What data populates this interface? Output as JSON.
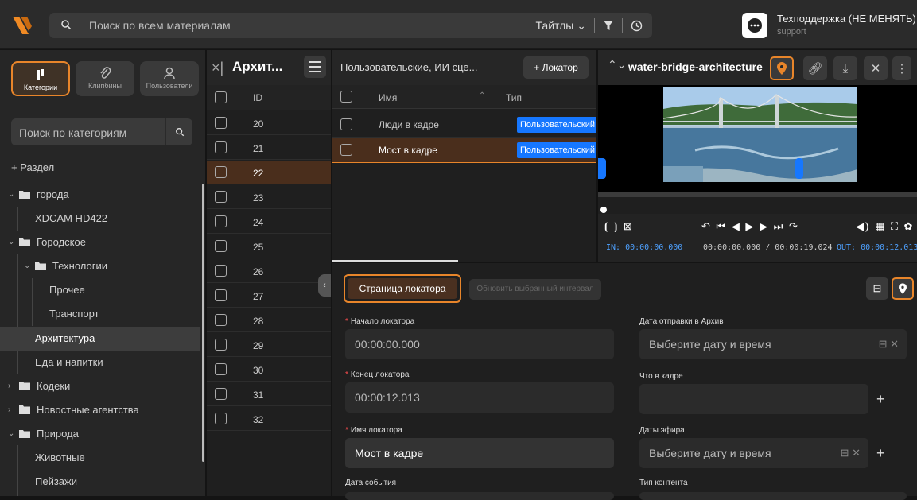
{
  "topbar": {
    "search_placeholder": "Поиск по всем материалам",
    "filter_label": "Тайтлы",
    "support_name": "Техподдержка (НЕ МЕНЯТЬ)",
    "support_role": "support"
  },
  "left": {
    "tabs": [
      {
        "label": "Категории",
        "icon": "categories-icon",
        "active": true
      },
      {
        "label": "Клипбины",
        "icon": "paperclip-icon",
        "active": false
      },
      {
        "label": "Пользователи",
        "icon": "user-icon",
        "active": false
      }
    ],
    "search_placeholder": "Поиск по категориям",
    "add_section": "+ Раздел",
    "tree": [
      {
        "label": "города",
        "level": 0,
        "folder": true,
        "expanded": true
      },
      {
        "label": "XDCAM HD422",
        "level": 1
      },
      {
        "label": "Городское",
        "level": 0,
        "folder": true,
        "expanded": true
      },
      {
        "label": "Технологии",
        "level": 1,
        "folder": true,
        "expanded": true
      },
      {
        "label": "Прочее",
        "level": 2
      },
      {
        "label": "Транспорт",
        "level": 2
      },
      {
        "label": "Архитектура",
        "level": 1,
        "selected": true
      },
      {
        "label": "Еда и напитки",
        "level": 1
      },
      {
        "label": "Кодеки",
        "level": 0,
        "folder": true,
        "expanded": false
      },
      {
        "label": "Новостные агентства",
        "level": 0,
        "folder": true,
        "expanded": false
      },
      {
        "label": "Природа",
        "level": 0,
        "folder": true,
        "expanded": true
      },
      {
        "label": "Животные",
        "level": 1
      },
      {
        "label": "Пейзажи",
        "level": 1
      }
    ]
  },
  "ids": {
    "title": "Архит...",
    "col_id": "ID",
    "rows": [
      "20",
      "21",
      "22",
      "23",
      "24",
      "25",
      "26",
      "27",
      "28",
      "29",
      "30",
      "31",
      "32"
    ],
    "selected": "22"
  },
  "locators": {
    "select_label": "Пользовательские, ИИ сце...",
    "add_button": "+ Локатор",
    "col_name": "Имя",
    "col_type": "Тип",
    "rows": [
      {
        "name": "Люди в кадре",
        "type": "Пользовательский"
      },
      {
        "name": "Мост в кадре",
        "type": "Пользовательский"
      }
    ]
  },
  "video": {
    "title": "water-bridge-architecture",
    "in_label": "IN: 00:00:00.000",
    "position": "00:00:00.000 / 00:00:19.024",
    "out_label": "OUT: 00:00:12.013",
    "progress": 0.0
  },
  "form": {
    "locator_page": "Страница локатора",
    "update_interval": "Обновить выбранный интервал",
    "start_label": "Начало локатора",
    "start_value": "00:00:00.000",
    "end_label": "Конец локатора",
    "end_value": "00:00:12.013",
    "name_label": "Имя локатора",
    "name_value": "Мост в кадре",
    "event_date_label": "Дата события",
    "archive_label": "Дата отправки в Архив",
    "archive_placeholder": "Выберите дату и время",
    "in_frame_label": "Что в кадре",
    "air_label": "Даты эфира",
    "air_placeholder": "Выберите дату и время",
    "content_type_label": "Тип контента"
  },
  "colors": {
    "accent": "#e8852a",
    "badge": "#1677ff",
    "required": "#ff4d4f"
  }
}
